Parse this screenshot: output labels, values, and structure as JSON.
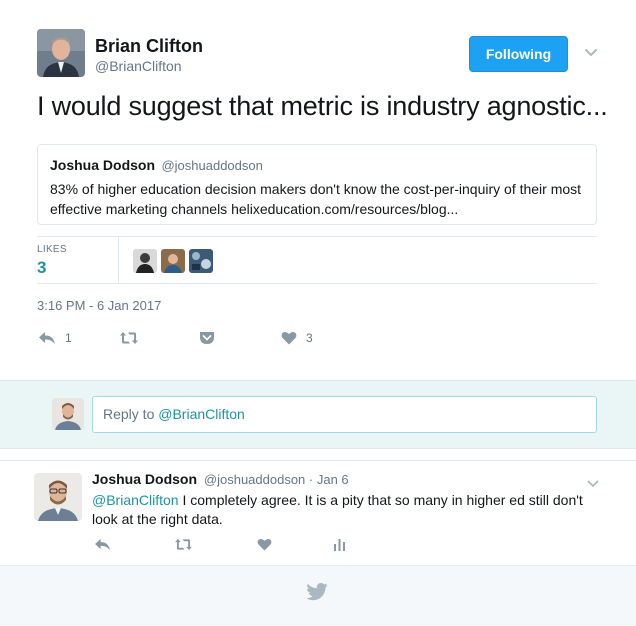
{
  "tweet": {
    "author_name": "Brian Clifton",
    "author_handle": "@BrianClifton",
    "follow_label": "Following",
    "text": "I would suggest that metric is industry agnostic...",
    "quote": {
      "name": "Joshua Dodson",
      "handle": "@joshuaddodson",
      "text": "83% of higher education decision makers don't know the cost-per-inquiry of their most effective marketing channels helixeducation.com/resources/blog..."
    },
    "likes_label": "LIKES",
    "likes_count": "3",
    "timestamp": "3:16 PM - 6 Jan 2017",
    "actions": {
      "reply_count": "1",
      "like_count": "3"
    }
  },
  "reply_box": {
    "placeholder_prefix": "Reply to ",
    "placeholder_mention": "@BrianClifton"
  },
  "reply": {
    "name": "Joshua Dodson",
    "handle": "@joshuaddodson",
    "date": "Jan 6",
    "separator": " · ",
    "mention": "@BrianClifton",
    "text": " I completely agree. It is a pity that so many in higher ed still don't look at the right data."
  },
  "colors": {
    "accent": "#1da1f2",
    "teal": "#1b95a0",
    "muted": "#657786",
    "reply_bg": "#eaf5f5"
  },
  "icons": [
    "caret-down-icon",
    "reply-icon",
    "retweet-icon",
    "pocket-icon",
    "heart-icon",
    "analytics-icon",
    "twitter-bird-icon"
  ]
}
